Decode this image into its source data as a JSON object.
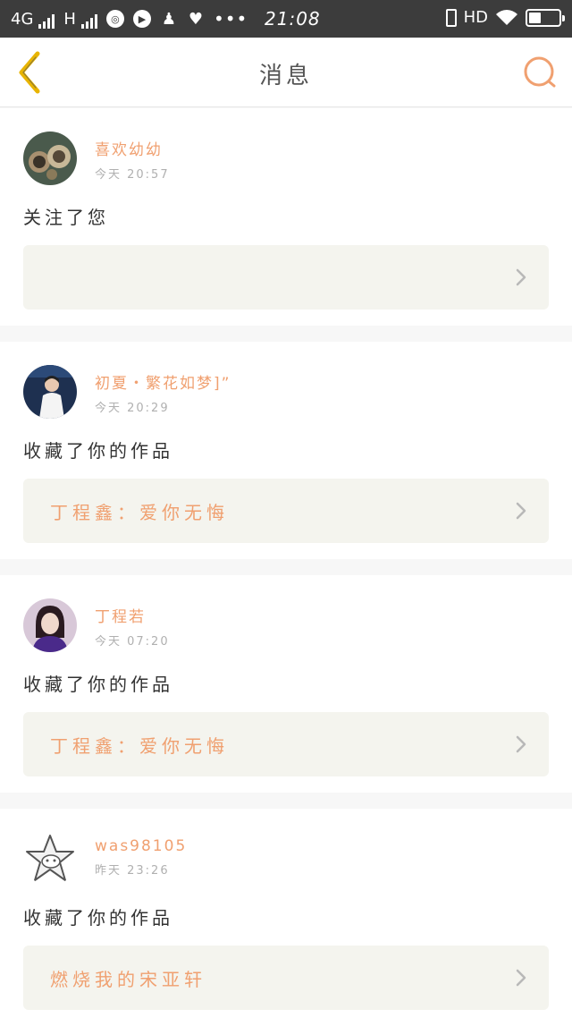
{
  "status_bar": {
    "network_1": "4G",
    "network_2": "H",
    "time": "21:08",
    "hd": "HD",
    "dots": "•••"
  },
  "header": {
    "title": "消息",
    "back_icon": "chevron-left-icon",
    "search_icon": "search-icon"
  },
  "accent_color": "#f0a070",
  "back_color": "#e8b400",
  "messages": [
    {
      "user": "喜欢幼幼",
      "time": "今天 20:57",
      "action": "关注了您",
      "work": ""
    },
    {
      "user": "初夏・繁花如梦]”",
      "time": "今天 20:29",
      "action": "收藏了你的作品",
      "work": "丁程鑫：爱你无悔"
    },
    {
      "user": "丁程若",
      "time": "今天 07:20",
      "action": "收藏了你的作品",
      "work": "丁程鑫：爱你无悔"
    },
    {
      "user": "was98105",
      "time": "昨天 23:26",
      "action": "收藏了你的作品",
      "work": "燃烧我的宋亚轩"
    }
  ]
}
